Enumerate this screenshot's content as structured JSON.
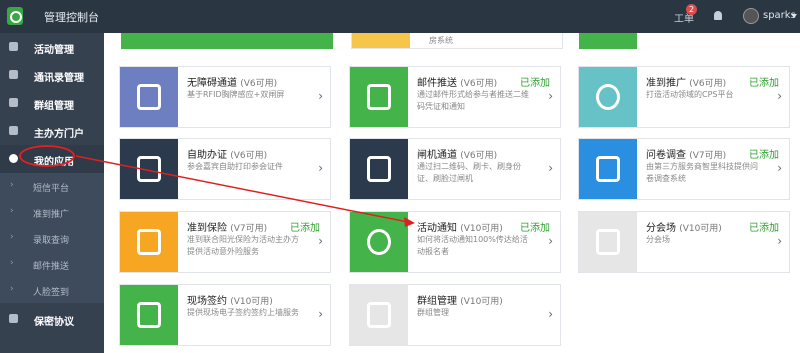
{
  "header": {
    "app_title": "管理控制台",
    "work_label": "工单",
    "work_badge": "2",
    "user_name": "sparks"
  },
  "sidebar": {
    "items": [
      {
        "label": "活动管理",
        "icon": "dashboard-icon"
      },
      {
        "label": "通讯录管理",
        "icon": "address-book-icon"
      },
      {
        "label": "群组管理",
        "icon": "group-icon"
      },
      {
        "label": "主办方门户",
        "icon": "portal-icon"
      },
      {
        "label": "我的应用",
        "icon": "app-icon"
      },
      {
        "label": "保密协议",
        "icon": "document-icon"
      }
    ],
    "sub_items": [
      "短信平台",
      "准到推广",
      "录取查询",
      "邮件推送",
      "人脸签到"
    ]
  },
  "top_partial": {
    "card_1_text": "",
    "card_2_text": "房系统"
  },
  "apps": [
    {
      "title": "无障碍通道",
      "version": "(V6可用)",
      "desc": "基于RFID胸牌感应+双闸屏",
      "added": "",
      "color": "#6d7fc1",
      "icon": "gate-icon"
    },
    {
      "title": "邮件推送",
      "version": "(V6可用)",
      "desc": "通过邮件形式给参与者推送二维码凭证和通知",
      "added": "已添加",
      "color": "#43b34a",
      "icon": "mail-icon"
    },
    {
      "title": "准到推广",
      "version": "(V6可用)",
      "desc": "打造活动领域的CPS平台",
      "added": "已添加",
      "color": "#67c2c8",
      "icon": "megaphone-icon"
    },
    {
      "title": "自助办证",
      "version": "(V6可用)",
      "desc": "参会嘉宾自助打印参会证件",
      "added": "",
      "color": "#2c3a4d",
      "icon": "printer-icon"
    },
    {
      "title": "闸机通道",
      "version": "(V6可用)",
      "desc": "通过扫二维码、刷卡、刷身份证、刷脸过闸机",
      "added": "",
      "color": "#2c3a4d",
      "icon": "turnstile-icon"
    },
    {
      "title": "问卷调查",
      "version": "(V7可用)",
      "desc": "由第三方服务商智里科技提供问卷调查系统",
      "added": "已添加",
      "color": "#2a8fe0",
      "icon": "survey-icon"
    },
    {
      "title": "准到保险",
      "version": "(V7可用)",
      "desc": "准到联合阳光保险为活动主办方提供活动意外险服务",
      "added": "已添加",
      "color": "#f6a623",
      "icon": "shield-icon"
    },
    {
      "title": "活动通知",
      "version": "(V10可用)",
      "desc": "如何将活动通知100%传达给活动报名者",
      "added": "已添加",
      "color": "#43b34a",
      "icon": "speaker-icon"
    },
    {
      "title": "分会场",
      "version": "(V10可用)",
      "desc": "分会场",
      "added": "已添加",
      "color": "#e6e6e6",
      "icon": "box-icon"
    },
    {
      "title": "现场签约",
      "version": "(V10可用)",
      "desc": "提供现场电子签约签约上墙服务",
      "added": "",
      "color": "#43b34a",
      "icon": "feather-icon"
    },
    {
      "title": "群组管理",
      "version": "(V10可用)",
      "desc": "群组管理",
      "added": "",
      "color": "#e6e6e6",
      "icon": "box-icon"
    }
  ],
  "colors": {
    "topbar": "#2b3643",
    "sidebar": "#364150",
    "added_green": "#2ea12e",
    "annotation_red": "#e02020"
  }
}
